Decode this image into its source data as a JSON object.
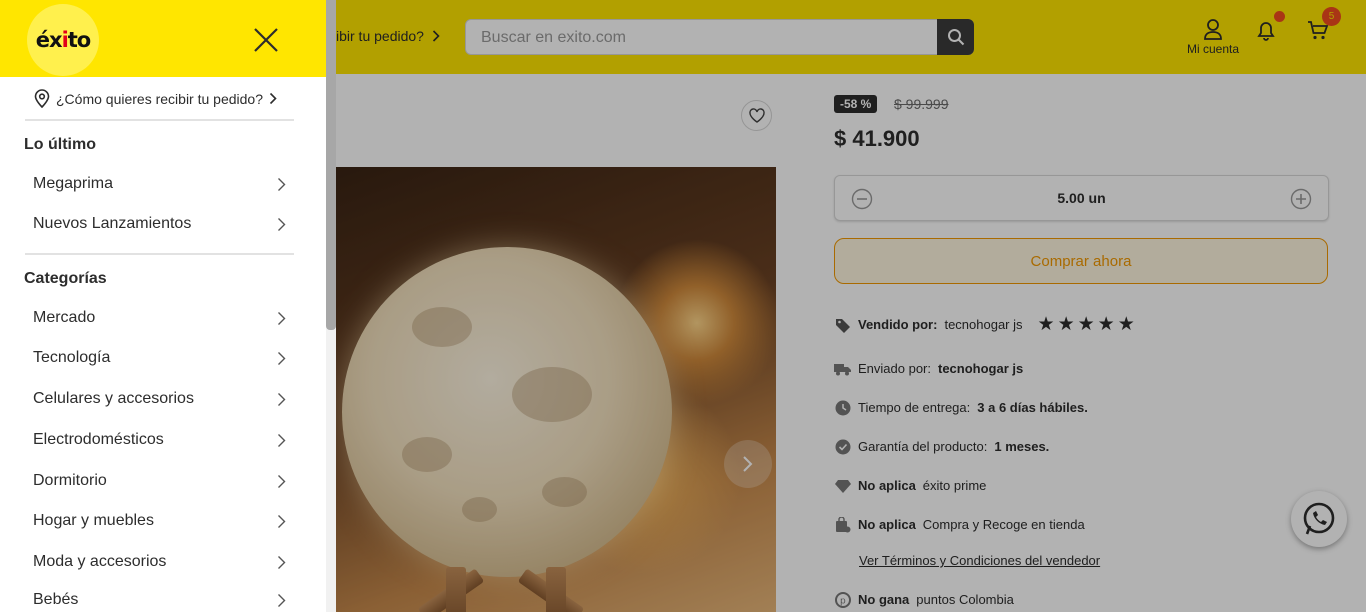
{
  "header": {
    "delivery_text": "ibir tu pedido?",
    "search_placeholder": "Buscar en exito.com",
    "account_label": "Mi cuenta",
    "cart_count": "5"
  },
  "product": {
    "discount": "-58 %",
    "old_price": "$ 99.999",
    "price": "$ 41.900",
    "quantity": "5.00 un",
    "buy_label": "Comprar ahora",
    "rating": 5,
    "sold_by_label": "Vendido por:",
    "sold_by_value": "tecnohogar js",
    "shipped_label": "Enviado por:",
    "shipped_value": "tecnohogar js",
    "delivery_label": "Tiempo de entrega:",
    "delivery_value": "3 a 6 días hábiles.",
    "warranty_label": "Garantía del producto:",
    "warranty_value": "1 meses.",
    "prime_bold": "No aplica",
    "prime_text": "éxito prime",
    "pickup_bold": "No aplica",
    "pickup_text": "Compra y Recoge en tienda",
    "terms_link": "Ver Términos y Condiciones del vendedor",
    "points_bold": "No gana",
    "points_text": "puntos Colombia"
  },
  "drawer": {
    "logo_pre": "éx",
    "logo_dot": "i",
    "logo_post": "to",
    "delivery_prompt": "¿Cómo quieres recibir tu pedido?",
    "section_latest": "Lo último",
    "latest_items": [
      "Megaprima",
      "Nuevos Lanzamientos"
    ],
    "section_categories": "Categorías",
    "category_items": [
      "Mercado",
      "Tecnología",
      "Celulares y accesorios",
      "Electrodomésticos",
      "Dormitorio",
      "Hogar y muebles",
      "Moda y accesorios",
      "Bebés"
    ]
  },
  "colors": {
    "brand_yellow": "#ffe600",
    "accent_orange": "#f29900",
    "badge_red": "#f24c1f"
  }
}
